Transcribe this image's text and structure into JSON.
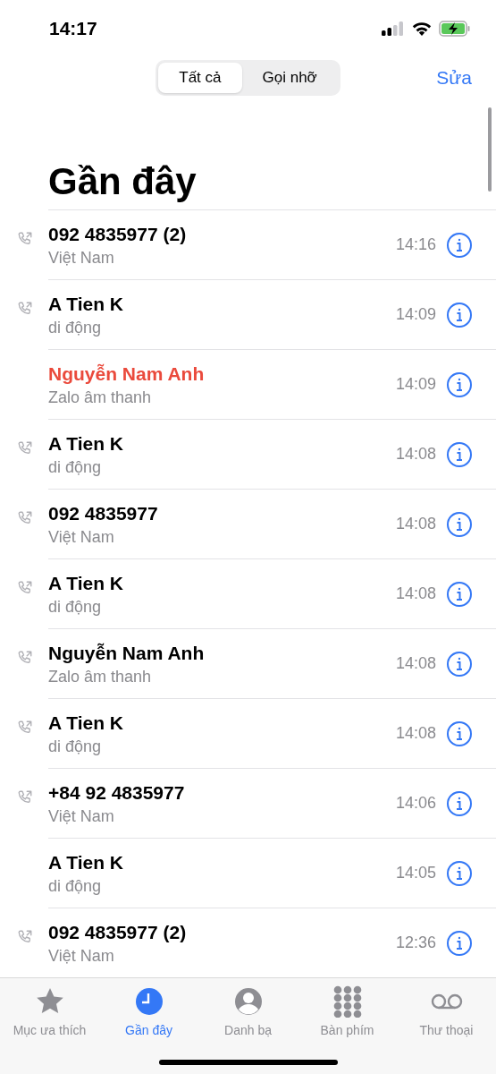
{
  "status_bar": {
    "time": "14:17"
  },
  "segments": [
    {
      "label": "Tất cả",
      "selected": true
    },
    {
      "label": "Gọi nhỡ",
      "selected": false
    }
  ],
  "edit_button": "Sửa",
  "title": "Gần đây",
  "calls": [
    {
      "name": "092 4835977 (2)",
      "detail": "Việt Nam",
      "time": "14:16",
      "outgoing": true,
      "missed": false
    },
    {
      "name": "A Tien K",
      "detail": "di động",
      "time": "14:09",
      "outgoing": true,
      "missed": false
    },
    {
      "name": "Nguyễn Nam Anh",
      "detail": "Zalo âm thanh",
      "time": "14:09",
      "outgoing": false,
      "missed": true
    },
    {
      "name": "A Tien K",
      "detail": "di động",
      "time": "14:08",
      "outgoing": true,
      "missed": false
    },
    {
      "name": "092 4835977",
      "detail": "Việt Nam",
      "time": "14:08",
      "outgoing": true,
      "missed": false
    },
    {
      "name": "A Tien K",
      "detail": "di động",
      "time": "14:08",
      "outgoing": true,
      "missed": false
    },
    {
      "name": "Nguyễn Nam Anh",
      "detail": "Zalo âm thanh",
      "time": "14:08",
      "outgoing": true,
      "missed": false
    },
    {
      "name": "A Tien K",
      "detail": "di động",
      "time": "14:08",
      "outgoing": true,
      "missed": false
    },
    {
      "name": "+84 92 4835977",
      "detail": "Việt Nam",
      "time": "14:06",
      "outgoing": true,
      "missed": false
    },
    {
      "name": "A Tien K",
      "detail": "di động",
      "time": "14:05",
      "outgoing": false,
      "missed": false
    },
    {
      "name": "092 4835977 (2)",
      "detail": "Việt Nam",
      "time": "12:36",
      "outgoing": true,
      "missed": false
    }
  ],
  "tab_bar": [
    {
      "kind": "star",
      "label": "Mục ưa thích",
      "selected": false
    },
    {
      "kind": "clock",
      "label": "Gần đây",
      "selected": true
    },
    {
      "kind": "person",
      "label": "Danh bạ",
      "selected": false
    },
    {
      "kind": "keypad",
      "label": "Bàn phím",
      "selected": false
    },
    {
      "kind": "voicemail",
      "label": "Thư thoại",
      "selected": false
    }
  ]
}
